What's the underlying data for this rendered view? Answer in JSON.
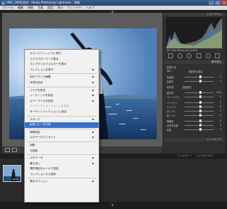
{
  "window": {
    "title": "[IMG_3966]全特 - Adobe Photoshop Lightroom - 現像",
    "minimize": "_",
    "maximize": "□",
    "close": "×"
  },
  "menubar": [
    "ファイル",
    "編集",
    "現像",
    "写真",
    "設定",
    "表示",
    "ウィンドウ",
    "ヘルプ"
  ],
  "right_panel": {
    "histogram_title": "ヒストグラム",
    "info1": "ISO 100  35mm  f/11  1/250",
    "info2": "元写真",
    "basic_title": "基本補正",
    "treatment": "処理方法 :",
    "wb": "WB :",
    "wb_value": "撮影時の設定",
    "sliders": [
      {
        "label": "色温度",
        "value": "0"
      },
      {
        "label": "色補正",
        "value": "0"
      },
      {
        "label": "素材調",
        "value": "自動設定"
      },
      {
        "label": "露光量",
        "value": "0.00"
      },
      {
        "label": "コントラスト",
        "value": "0"
      },
      {
        "label": "ハイライト",
        "value": "0"
      },
      {
        "label": "シャドウ",
        "value": "0"
      },
      {
        "label": "白レベル",
        "value": "0"
      },
      {
        "label": "黒レベル",
        "value": "0"
      },
      {
        "label": "明瞭度",
        "value": "0"
      },
      {
        "label": "自然な彩度",
        "value": "0"
      },
      {
        "label": "彩度",
        "value": "0"
      }
    ],
    "tonecurve": "トーンカーブ",
    "btn_prev": "前の設定",
    "btn_reset": "初期化"
  },
  "toolbar": {
    "label": "ソフト校正"
  },
  "filmstrip": {
    "header": "前回の読み込み  1枚 / 1枚を選択  /IMG_3966.CR2",
    "filter": "フィルター :",
    "filter_value": "フィルターオフ",
    "thumb_badge": "[RAW]"
  },
  "context_menu": {
    "items": [
      {
        "label": "セカンドウィンドウに表示",
        "arrow": false,
        "state": "normal"
      },
      {
        "label": "エクスプローラーで表示",
        "arrow": false,
        "state": "normal"
      },
      {
        "label": "ライブラリのフォルダーを表示",
        "arrow": false,
        "state": "normal"
      },
      {
        "label": "コレクションを表示",
        "arrow": true,
        "state": "normal"
      },
      {
        "sep": true
      },
      {
        "label": "別のアプリで編集",
        "arrow": true,
        "state": "normal"
      },
      {
        "label": "写真を結合",
        "arrow": true,
        "state": "normal"
      },
      {
        "sep": true
      },
      {
        "label": "フラグを設定",
        "arrow": true,
        "state": "normal"
      },
      {
        "label": "レーティングを設定",
        "arrow": true,
        "state": "normal"
      },
      {
        "label": "カラーラベルを設定",
        "arrow": true,
        "state": "normal"
      },
      {
        "label": "キーワードショートカットを追加",
        "arrow": false,
        "state": "disabled"
      },
      {
        "label": "ターゲットコレクションに追加",
        "arrow": false,
        "state": "normal"
      },
      {
        "sep": true
      },
      {
        "label": "スタック",
        "arrow": true,
        "state": "normal"
      },
      {
        "label": "仮想コピーを作成",
        "arrow": false,
        "state": "highlight"
      },
      {
        "sep": true
      },
      {
        "label": "現像設定",
        "arrow": true,
        "state": "normal"
      },
      {
        "label": "メタデータプリセット",
        "arrow": true,
        "state": "normal"
      },
      {
        "sep": true
      },
      {
        "label": "回転",
        "arrow": false,
        "state": "normal"
      },
      {
        "label": "左回転",
        "arrow": false,
        "state": "normal"
      },
      {
        "sep": true
      },
      {
        "label": "メタデータ",
        "arrow": true,
        "state": "normal"
      },
      {
        "label": "書き出し",
        "arrow": true,
        "state": "normal"
      },
      {
        "label": "選択項目をメールで送信",
        "arrow": false,
        "state": "normal"
      },
      {
        "label": "コレクションから削除",
        "arrow": false,
        "state": "normal"
      },
      {
        "sep": true
      },
      {
        "label": "表示オプション",
        "arrow": true,
        "state": "normal"
      }
    ]
  },
  "colors": {
    "accent": "#3b6fc9",
    "panel": "#303030",
    "titlebar": "#3c5e93"
  }
}
